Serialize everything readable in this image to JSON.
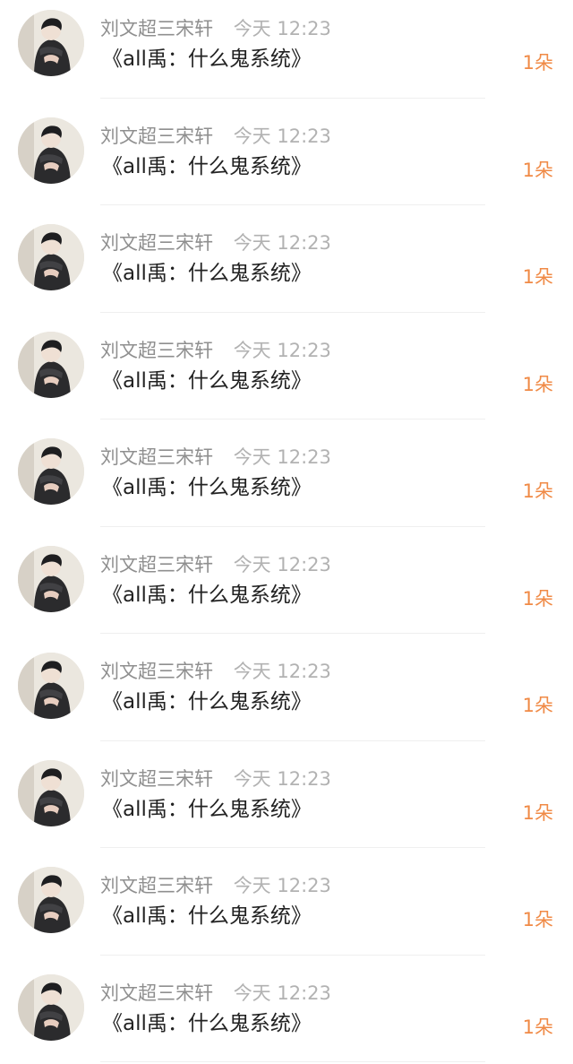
{
  "feed": {
    "items": [
      {
        "author": "刘文超三宋轩",
        "time": "今天 12:23",
        "title": "《all禹：什么鬼系统》",
        "count": "1朵",
        "avatar_icon": "user-avatar-icon"
      },
      {
        "author": "刘文超三宋轩",
        "time": "今天 12:23",
        "title": "《all禹：什么鬼系统》",
        "count": "1朵",
        "avatar_icon": "user-avatar-icon"
      },
      {
        "author": "刘文超三宋轩",
        "time": "今天 12:23",
        "title": "《all禹：什么鬼系统》",
        "count": "1朵",
        "avatar_icon": "user-avatar-icon"
      },
      {
        "author": "刘文超三宋轩",
        "time": "今天 12:23",
        "title": "《all禹：什么鬼系统》",
        "count": "1朵",
        "avatar_icon": "user-avatar-icon"
      },
      {
        "author": "刘文超三宋轩",
        "time": "今天 12:23",
        "title": "《all禹：什么鬼系统》",
        "count": "1朵",
        "avatar_icon": "user-avatar-icon"
      },
      {
        "author": "刘文超三宋轩",
        "time": "今天 12:23",
        "title": "《all禹：什么鬼系统》",
        "count": "1朵",
        "avatar_icon": "user-avatar-icon"
      },
      {
        "author": "刘文超三宋轩",
        "time": "今天 12:23",
        "title": "《all禹：什么鬼系统》",
        "count": "1朵",
        "avatar_icon": "user-avatar-icon"
      },
      {
        "author": "刘文超三宋轩",
        "time": "今天 12:23",
        "title": "《all禹：什么鬼系统》",
        "count": "1朵",
        "avatar_icon": "user-avatar-icon"
      },
      {
        "author": "刘文超三宋轩",
        "time": "今天 12:23",
        "title": "《all禹：什么鬼系统》",
        "count": "1朵",
        "avatar_icon": "user-avatar-icon"
      },
      {
        "author": "刘文超三宋轩",
        "time": "今天 12:23",
        "title": "《all禹：什么鬼系统》",
        "count": "1朵",
        "avatar_icon": "user-avatar-icon"
      }
    ]
  },
  "colors": {
    "background": "#ffffff",
    "author_text": "#8f8f8f",
    "time_text": "#b2b2b2",
    "title_text": "#222222",
    "count_accent": "#f08a46",
    "divider": "#efefef"
  }
}
